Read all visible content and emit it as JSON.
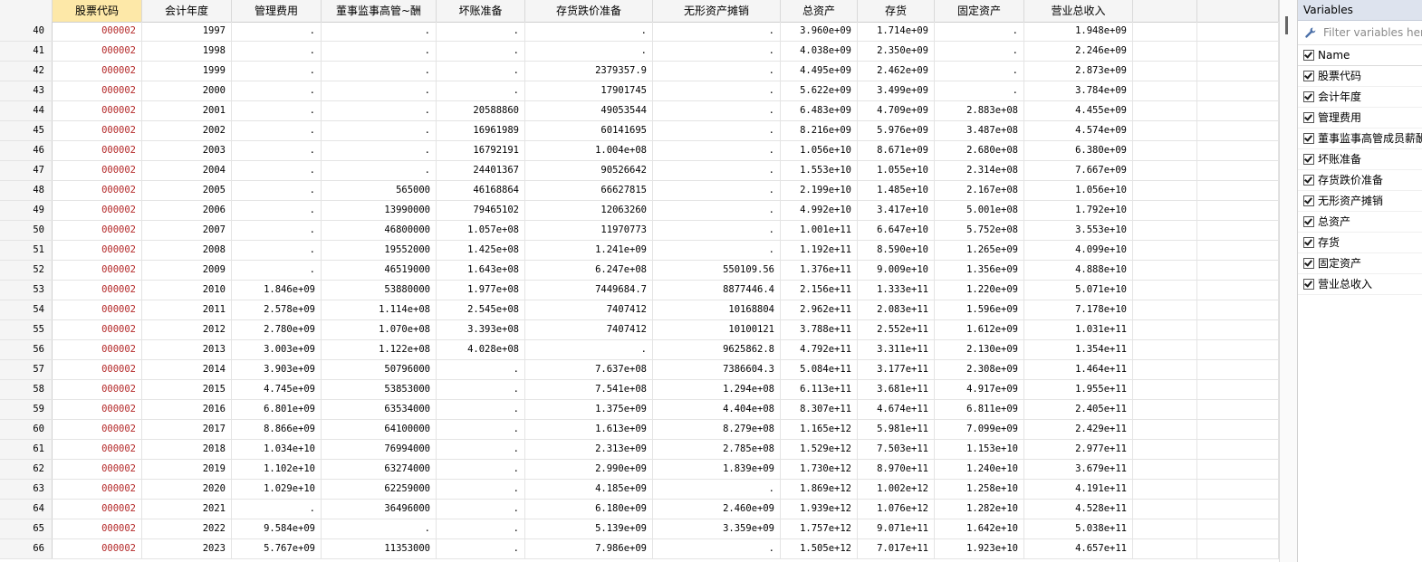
{
  "grid": {
    "columns": [
      "股票代码",
      "会计年度",
      "管理费用",
      "董事监事高管~酬",
      "坏账准备",
      "存货跌价准备",
      "无形资产摊销",
      "总资产",
      "存货",
      "固定资产",
      "营业总收入"
    ],
    "selected_column": 0,
    "rows": [
      [
        "40",
        "000002",
        "1997",
        ".",
        ".",
        ".",
        ".",
        ".",
        "3.960e+09",
        "1.714e+09",
        ".",
        "1.948e+09"
      ],
      [
        "41",
        "000002",
        "1998",
        ".",
        ".",
        ".",
        ".",
        ".",
        "4.038e+09",
        "2.350e+09",
        ".",
        "2.246e+09"
      ],
      [
        "42",
        "000002",
        "1999",
        ".",
        ".",
        ".",
        "2379357.9",
        ".",
        "4.495e+09",
        "2.462e+09",
        ".",
        "2.873e+09"
      ],
      [
        "43",
        "000002",
        "2000",
        ".",
        ".",
        ".",
        "17901745",
        ".",
        "5.622e+09",
        "3.499e+09",
        ".",
        "3.784e+09"
      ],
      [
        "44",
        "000002",
        "2001",
        ".",
        ".",
        "20588860",
        "49053544",
        ".",
        "6.483e+09",
        "4.709e+09",
        "2.883e+08",
        "4.455e+09"
      ],
      [
        "45",
        "000002",
        "2002",
        ".",
        ".",
        "16961989",
        "60141695",
        ".",
        "8.216e+09",
        "5.976e+09",
        "3.487e+08",
        "4.574e+09"
      ],
      [
        "46",
        "000002",
        "2003",
        ".",
        ".",
        "16792191",
        "1.004e+08",
        ".",
        "1.056e+10",
        "8.671e+09",
        "2.680e+08",
        "6.380e+09"
      ],
      [
        "47",
        "000002",
        "2004",
        ".",
        ".",
        "24401367",
        "90526642",
        ".",
        "1.553e+10",
        "1.055e+10",
        "2.314e+08",
        "7.667e+09"
      ],
      [
        "48",
        "000002",
        "2005",
        ".",
        "565000",
        "46168864",
        "66627815",
        ".",
        "2.199e+10",
        "1.485e+10",
        "2.167e+08",
        "1.056e+10"
      ],
      [
        "49",
        "000002",
        "2006",
        ".",
        "13990000",
        "79465102",
        "12063260",
        ".",
        "4.992e+10",
        "3.417e+10",
        "5.001e+08",
        "1.792e+10"
      ],
      [
        "50",
        "000002",
        "2007",
        ".",
        "46800000",
        "1.057e+08",
        "11970773",
        ".",
        "1.001e+11",
        "6.647e+10",
        "5.752e+08",
        "3.553e+10"
      ],
      [
        "51",
        "000002",
        "2008",
        ".",
        "19552000",
        "1.425e+08",
        "1.241e+09",
        ".",
        "1.192e+11",
        "8.590e+10",
        "1.265e+09",
        "4.099e+10"
      ],
      [
        "52",
        "000002",
        "2009",
        ".",
        "46519000",
        "1.643e+08",
        "6.247e+08",
        "550109.56",
        "1.376e+11",
        "9.009e+10",
        "1.356e+09",
        "4.888e+10"
      ],
      [
        "53",
        "000002",
        "2010",
        "1.846e+09",
        "53880000",
        "1.977e+08",
        "7449684.7",
        "8877446.4",
        "2.156e+11",
        "1.333e+11",
        "1.220e+09",
        "5.071e+10"
      ],
      [
        "54",
        "000002",
        "2011",
        "2.578e+09",
        "1.114e+08",
        "2.545e+08",
        "7407412",
        "10168804",
        "2.962e+11",
        "2.083e+11",
        "1.596e+09",
        "7.178e+10"
      ],
      [
        "55",
        "000002",
        "2012",
        "2.780e+09",
        "1.070e+08",
        "3.393e+08",
        "7407412",
        "10100121",
        "3.788e+11",
        "2.552e+11",
        "1.612e+09",
        "1.031e+11"
      ],
      [
        "56",
        "000002",
        "2013",
        "3.003e+09",
        "1.122e+08",
        "4.028e+08",
        ".",
        "9625862.8",
        "4.792e+11",
        "3.311e+11",
        "2.130e+09",
        "1.354e+11"
      ],
      [
        "57",
        "000002",
        "2014",
        "3.903e+09",
        "50796000",
        ".",
        "7.637e+08",
        "7386604.3",
        "5.084e+11",
        "3.177e+11",
        "2.308e+09",
        "1.464e+11"
      ],
      [
        "58",
        "000002",
        "2015",
        "4.745e+09",
        "53853000",
        ".",
        "7.541e+08",
        "1.294e+08",
        "6.113e+11",
        "3.681e+11",
        "4.917e+09",
        "1.955e+11"
      ],
      [
        "59",
        "000002",
        "2016",
        "6.801e+09",
        "63534000",
        ".",
        "1.375e+09",
        "4.404e+08",
        "8.307e+11",
        "4.674e+11",
        "6.811e+09",
        "2.405e+11"
      ],
      [
        "60",
        "000002",
        "2017",
        "8.866e+09",
        "64100000",
        ".",
        "1.613e+09",
        "8.279e+08",
        "1.165e+12",
        "5.981e+11",
        "7.099e+09",
        "2.429e+11"
      ],
      [
        "61",
        "000002",
        "2018",
        "1.034e+10",
        "76994000",
        ".",
        "2.313e+09",
        "2.785e+08",
        "1.529e+12",
        "7.503e+11",
        "1.153e+10",
        "2.977e+11"
      ],
      [
        "62",
        "000002",
        "2019",
        "1.102e+10",
        "63274000",
        ".",
        "2.990e+09",
        "1.839e+09",
        "1.730e+12",
        "8.970e+11",
        "1.240e+10",
        "3.679e+11"
      ],
      [
        "63",
        "000002",
        "2020",
        "1.029e+10",
        "62259000",
        ".",
        "4.185e+09",
        ".",
        "1.869e+12",
        "1.002e+12",
        "1.258e+10",
        "4.191e+11"
      ],
      [
        "64",
        "000002",
        "2021",
        ".",
        "36496000",
        ".",
        "6.180e+09",
        "2.460e+09",
        "1.939e+12",
        "1.076e+12",
        "1.282e+10",
        "4.528e+11"
      ],
      [
        "65",
        "000002",
        "2022",
        "9.584e+09",
        ".",
        ".",
        "5.139e+09",
        "3.359e+09",
        "1.757e+12",
        "9.071e+11",
        "1.642e+10",
        "5.038e+11"
      ],
      [
        "66",
        "000002",
        "2023",
        "5.767e+09",
        "11353000",
        ".",
        "7.986e+09",
        ".",
        "1.505e+12",
        "7.017e+11",
        "1.923e+10",
        "4.657e+11"
      ]
    ]
  },
  "variables": {
    "title": "Variables",
    "filter_placeholder": "Filter variables here",
    "header": "Name",
    "items": [
      "股票代码",
      "会计年度",
      "管理费用",
      "董事监事高管成员薪酬",
      "坏账准备",
      "存货跌价准备",
      "无形资产摊销",
      "总资产",
      "存货",
      "固定资产",
      "营业总收入"
    ]
  },
  "colors": {
    "selected_header": "#fde8a8",
    "code_text": "#b42828",
    "panel_title": "#dde3ee"
  }
}
